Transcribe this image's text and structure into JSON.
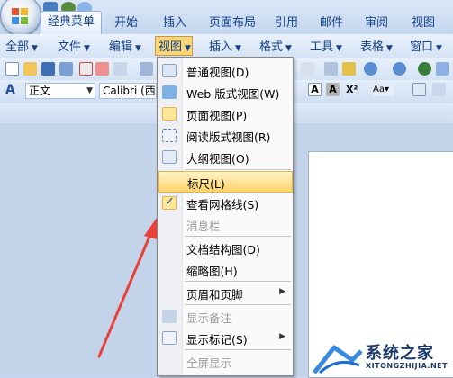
{
  "ribbon_tabs": [
    "经典菜单",
    "开始",
    "插入",
    "页面布局",
    "引用",
    "邮件",
    "审阅",
    "视图"
  ],
  "menubar": [
    {
      "label": "全部"
    },
    {
      "label": "文件"
    },
    {
      "label": "编辑"
    },
    {
      "label": "视图"
    },
    {
      "label": "插入"
    },
    {
      "label": "格式"
    },
    {
      "label": "工具"
    },
    {
      "label": "表格"
    },
    {
      "label": "窗口"
    }
  ],
  "toolbar": {
    "style_value": "正文",
    "font_value": "Calibri (西文"
  },
  "view_menu": {
    "items": [
      {
        "label": "普通视图(D)",
        "icon": "normal-view-icon",
        "state": "normal"
      },
      {
        "label": "Web 版式视图(W)",
        "icon": "web-layout-icon",
        "state": "normal"
      },
      {
        "label": "页面视图(P)",
        "icon": "page-view-icon",
        "state": "active"
      },
      {
        "label": "阅读版式视图(R)",
        "icon": "reading-layout-icon",
        "state": "normal"
      },
      {
        "label": "大纲视图(O)",
        "icon": "outline-view-icon",
        "state": "normal"
      },
      {
        "label": "标尺(L)",
        "icon": "",
        "state": "highlighted"
      },
      {
        "label": "查看网格线(S)",
        "icon": "checkmark-icon",
        "state": "checked"
      },
      {
        "label": "消息栏",
        "icon": "",
        "state": "disabled"
      },
      {
        "label": "文档结构图(D)",
        "icon": "",
        "state": "normal"
      },
      {
        "label": "缩略图(H)",
        "icon": "",
        "state": "normal"
      },
      {
        "label": "页眉和页脚",
        "icon": "",
        "state": "submenu"
      },
      {
        "label": "显示备注",
        "icon": "comments-icon",
        "state": "disabled"
      },
      {
        "label": "显示标记(S)",
        "icon": "markup-icon",
        "state": "submenu"
      },
      {
        "label": "全屏显示",
        "icon": "",
        "state": "disabled"
      }
    ]
  },
  "watermark": {
    "title": "系统之家",
    "url": "XITONGZHIJIA.NET"
  },
  "colors": {
    "accent": "#f9d779",
    "menu_highlight": "#ffd36a",
    "arrow": "#e8413a",
    "ribbon": "#c3d6ee"
  }
}
